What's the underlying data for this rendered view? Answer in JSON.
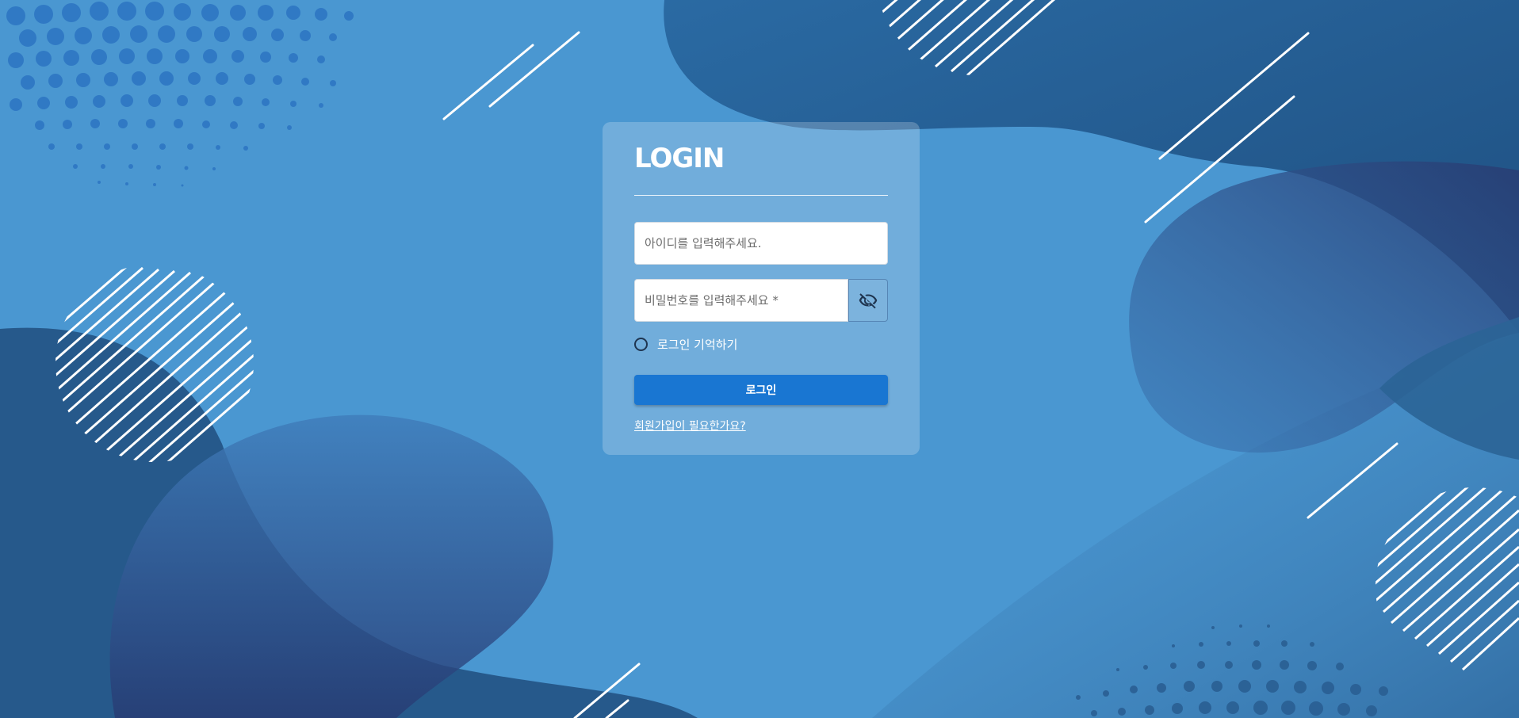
{
  "login": {
    "title": "LOGIN",
    "id_placeholder": "아이디를 입력해주세요.",
    "password_placeholder": "비밀번호를 입력해주세요 *",
    "remember_label": "로그인 기억하기",
    "submit_label": "로그인",
    "signup_link": "회원가입이 필요한가요?",
    "password_toggle_icon": "eye-off-icon"
  },
  "colors": {
    "background": "#4a97d1",
    "card": "rgba(255,255,255,0.22)",
    "button": "#1976d2",
    "dark_blob": "#245a8a",
    "navy_blob": "#2a3f78"
  }
}
